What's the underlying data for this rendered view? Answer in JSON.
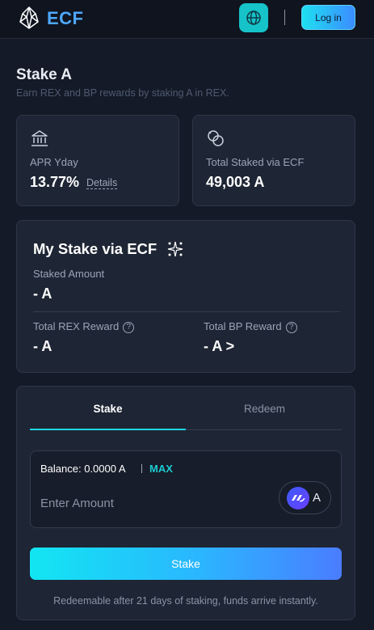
{
  "header": {
    "brand": "ECF",
    "login_label": "Log in"
  },
  "page": {
    "title": "Stake A",
    "subtitle": "Earn REX and BP rewards by staking A in REX."
  },
  "stats": {
    "apr_label": "APR Yday",
    "apr_value": "13.77%",
    "details_label": "Details",
    "total_label": "Total Staked via ECF",
    "total_value": "49,003 A"
  },
  "my_stake": {
    "title": "My Stake via ECF",
    "staked_label": "Staked Amount",
    "staked_value": "- A",
    "rex_label": "Total REX Reward",
    "rex_value": "- A",
    "bp_label": "Total BP Reward",
    "bp_value": "- A >"
  },
  "form": {
    "tabs": [
      "Stake",
      "Redeem"
    ],
    "balance_text": "Balance: 0.0000 A",
    "max_label": "MAX",
    "amount_placeholder": "Enter Amount",
    "token_name": "A",
    "submit_label": "Stake",
    "footnote": "Redeemable after 21 days of staking, funds arrive instantly."
  },
  "colors": {
    "accent": "#1ed6e0",
    "brand": "#4ea8ff",
    "background": "#141a27",
    "card": "#1e2534"
  },
  "icons": [
    "logo-icon",
    "globe-icon",
    "bank-icon",
    "rings-icon",
    "sparkle-icon",
    "help-icon",
    "token-icon"
  ]
}
